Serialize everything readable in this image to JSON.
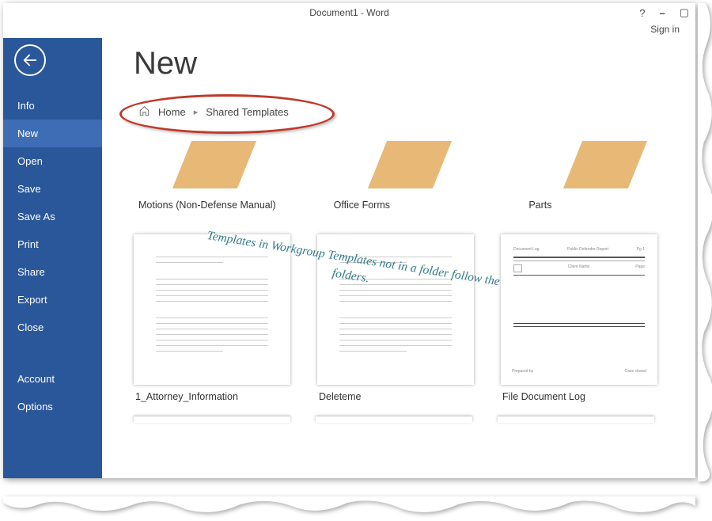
{
  "titlebar": {
    "title": "Document1 - Word",
    "signin": "Sign in"
  },
  "sidebar": {
    "items": [
      {
        "label": "Info"
      },
      {
        "label": "New"
      },
      {
        "label": "Open"
      },
      {
        "label": "Save"
      },
      {
        "label": "Save As"
      },
      {
        "label": "Print"
      },
      {
        "label": "Share"
      },
      {
        "label": "Export"
      },
      {
        "label": "Close"
      }
    ],
    "bottom": [
      {
        "label": "Account"
      },
      {
        "label": "Options"
      }
    ],
    "activeIndex": 1
  },
  "page": {
    "title": "New"
  },
  "breadcrumb": {
    "home": "Home",
    "path": "Shared Templates"
  },
  "folders": [
    {
      "label": "Motions (Non-Defense Manual)"
    },
    {
      "label": "Office Forms"
    },
    {
      "label": "Parts"
    }
  ],
  "templates": [
    {
      "label": "1_Attorney_Information",
      "type": "lines"
    },
    {
      "label": "Deleteme",
      "type": "lines"
    },
    {
      "label": "File Document Log",
      "type": "log"
    }
  ],
  "annotation": "Templates in Workgroup Templates not\nin a folder follow the folders."
}
